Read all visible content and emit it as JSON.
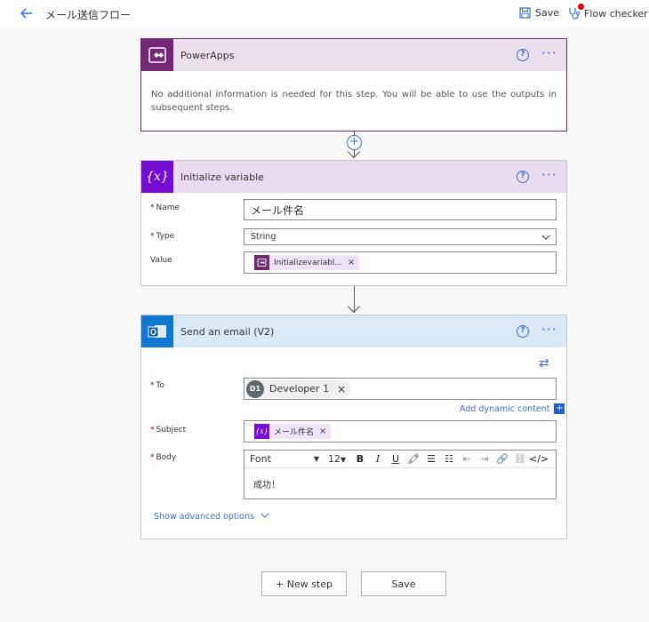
{
  "topbar": {
    "title": "メール送信フロー",
    "save_label": "Save",
    "checker_label": "Flow checker"
  },
  "powerapps": {
    "title": "PowerApps",
    "body": "No additional information is needed for this step. You will be able to use the outputs in subsequent steps."
  },
  "initvar": {
    "title": "Initialize variable",
    "name_label": "Name",
    "name_value": "メール件名",
    "type_label": "Type",
    "type_value": "String",
    "value_label": "Value",
    "value_token": "Initializevariabl..."
  },
  "email": {
    "title": "Send an email (V2)",
    "to_label": "To",
    "to_person_initials": "D1",
    "to_person_name": "Developer 1",
    "add_dynamic": "Add dynamic content",
    "subject_label": "Subject",
    "subject_token": "メール件名",
    "body_label": "Body",
    "font_label": "Font",
    "font_size": "12",
    "body_text": "成功！",
    "show_advanced": "Show advanced options"
  },
  "bottom": {
    "new_step": "+ New step",
    "save": "Save"
  },
  "colors": {
    "powerapps": "#742774",
    "variable": "#770bd6",
    "outlook": "#0f78d4",
    "link": "#3b6fd4"
  }
}
